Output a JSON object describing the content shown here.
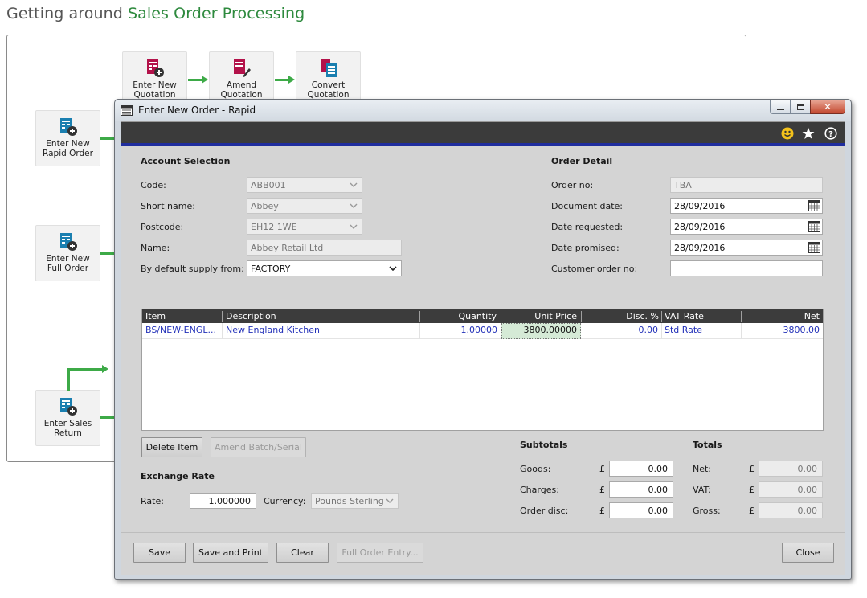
{
  "page": {
    "title_prefix": "Getting around",
    "title_accent": "Sales Order Processing"
  },
  "diagram": {
    "nodes": {
      "enter_new_quotation": [
        "Enter New",
        "Quotation"
      ],
      "amend_quotation": [
        "Amend",
        "Quotation"
      ],
      "convert_quotation": [
        "Convert",
        "Quotation"
      ],
      "enter_new_rapid_order": [
        "Enter New",
        "Rapid Order"
      ],
      "enter_new_full_order": [
        "Enter New",
        "Full Order"
      ],
      "enter_sales_return": [
        "Enter Sales",
        "Return"
      ]
    }
  },
  "window": {
    "title": "Enter New Order - Rapid"
  },
  "account": {
    "header": "Account Selection",
    "code_label": "Code:",
    "code_value": "ABB001",
    "short_name_label": "Short name:",
    "short_name_value": "Abbey",
    "postcode_label": "Postcode:",
    "postcode_value": "EH12 1WE",
    "name_label": "Name:",
    "name_value": "Abbey Retail Ltd",
    "supply_label": "By default supply from:",
    "supply_value": "FACTORY"
  },
  "order_detail": {
    "header": "Order Detail",
    "order_no_label": "Order no:",
    "order_no_value": "TBA",
    "document_date_label": "Document date:",
    "document_date_value": "28/09/2016",
    "date_requested_label": "Date requested:",
    "date_requested_value": "28/09/2016",
    "date_promised_label": "Date promised:",
    "date_promised_value": "28/09/2016",
    "customer_order_label": "Customer order no:",
    "customer_order_value": ""
  },
  "grid": {
    "columns": [
      "Item",
      "Description",
      "Quantity",
      "Unit Price",
      "Disc. %",
      "VAT Rate",
      "Net"
    ],
    "rows": [
      {
        "item": "BS/NEW-ENGL...",
        "description": "New England Kitchen",
        "quantity": "1.00000",
        "unit_price": "3800.00000",
        "disc": "0.00",
        "vat_rate": "Std Rate",
        "net": "3800.00"
      }
    ]
  },
  "buttons": {
    "delete_item": "Delete Item",
    "amend_batch": "Amend Batch/Serial",
    "save": "Save",
    "save_print": "Save and Print",
    "clear": "Clear",
    "full_order_entry": "Full Order Entry...",
    "close": "Close"
  },
  "exchange": {
    "header": "Exchange Rate",
    "rate_label": "Rate:",
    "rate_value": "1.000000",
    "currency_label": "Currency:",
    "currency_value": "Pounds Sterling"
  },
  "subtotals": {
    "header": "Subtotals",
    "goods_label": "Goods:",
    "goods_value": "0.00",
    "charges_label": "Charges:",
    "charges_value": "0.00",
    "order_disc_label": "Order disc:",
    "order_disc_value": "0.00",
    "currency_symbol": "£"
  },
  "totals": {
    "header": "Totals",
    "net_label": "Net:",
    "net_value": "0.00",
    "vat_label": "VAT:",
    "vat_value": "0.00",
    "gross_label": "Gross:",
    "gross_value": "0.00",
    "currency_symbol": "£"
  },
  "colors": {
    "accent_green": "#2e8a3e",
    "arrow_green": "#3daa47",
    "toolbar_dark": "#3b3b3b",
    "toolbar_stripe": "#1f2d9e",
    "grid_text_blue": "#2230b8"
  },
  "icons": [
    "smiley-icon",
    "star-icon",
    "help-icon",
    "calendar-icon",
    "chevron-down-icon"
  ]
}
